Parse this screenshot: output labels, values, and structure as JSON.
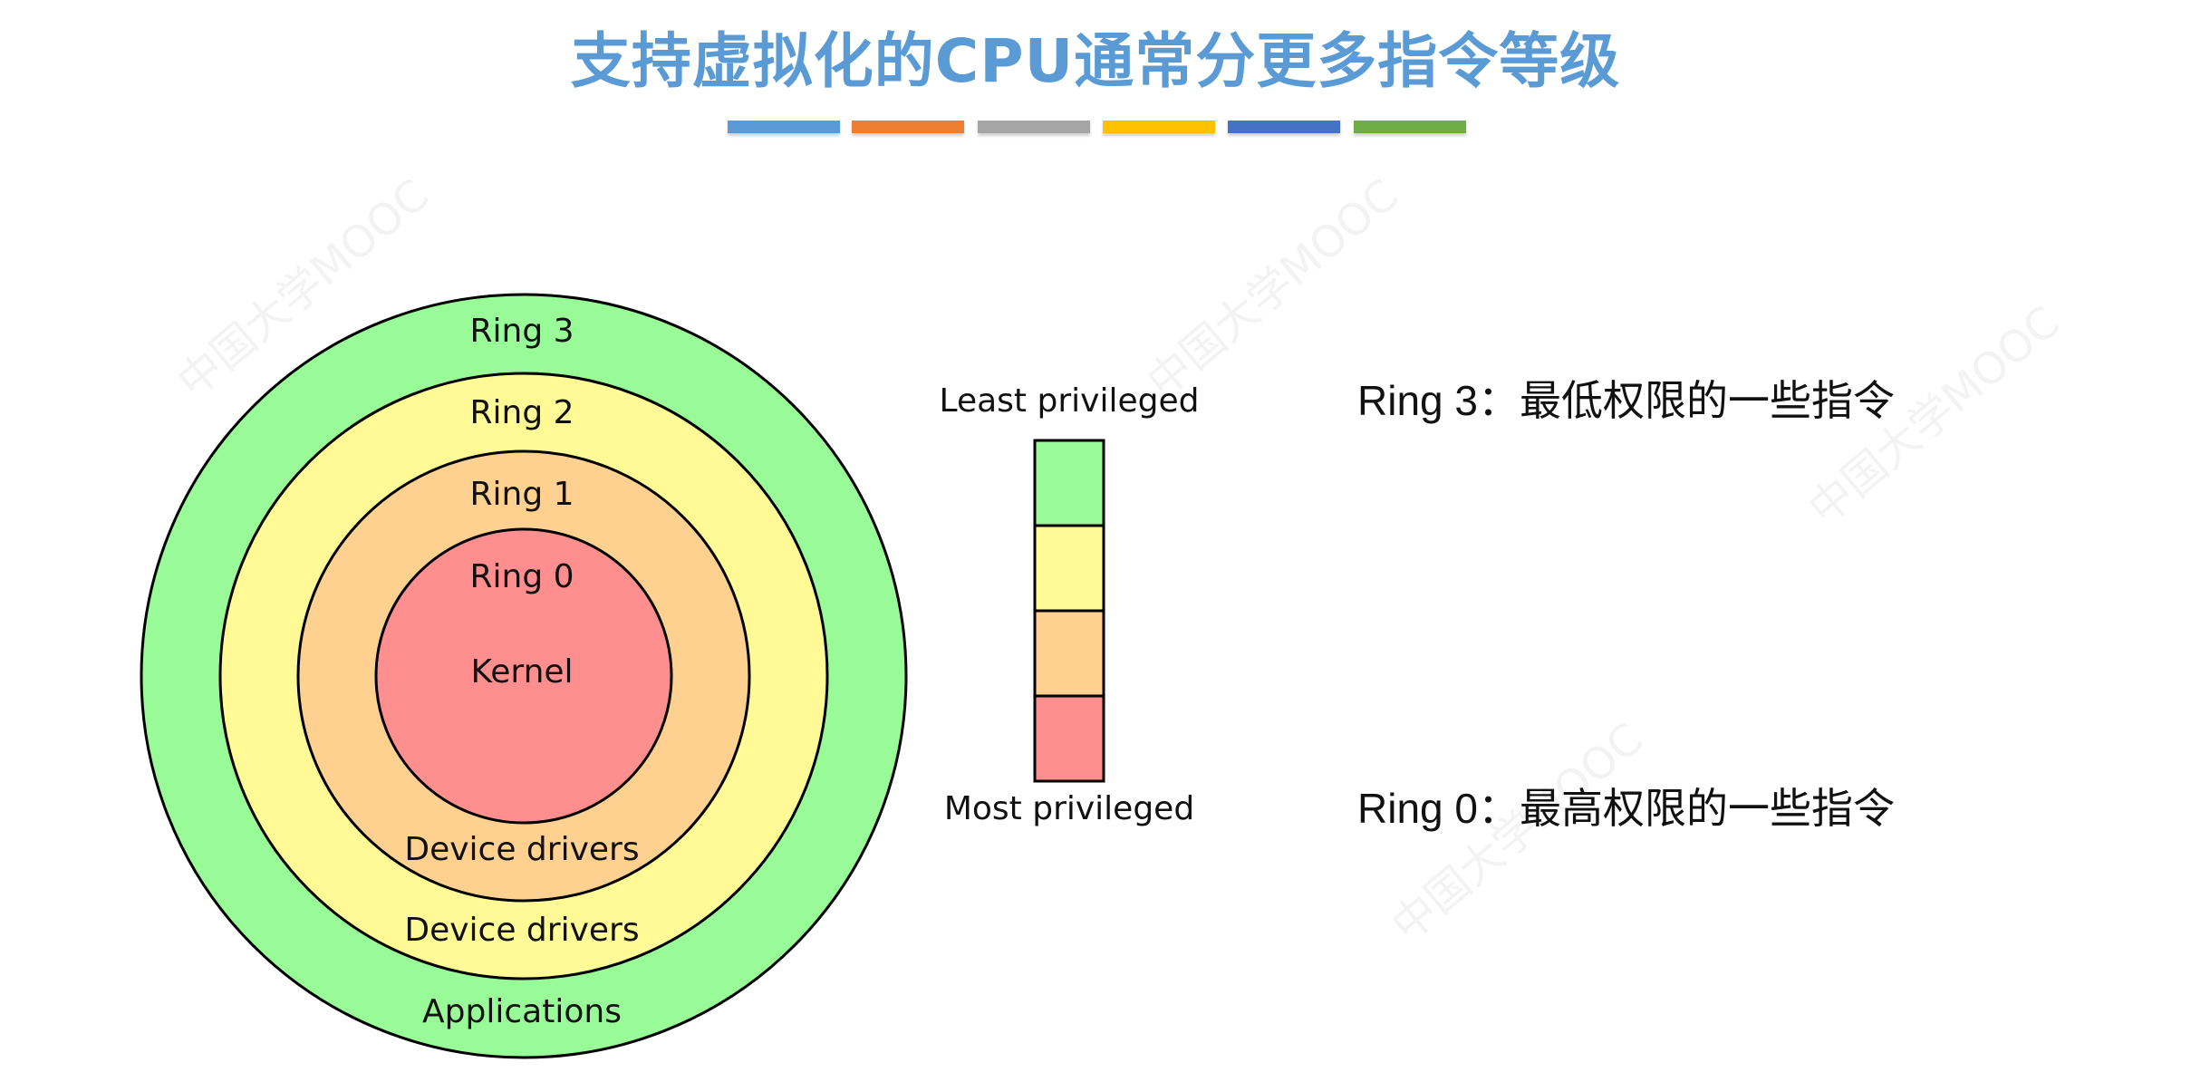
{
  "slide": {
    "title": "支持虚拟化的CPU通常分更多指令等级",
    "accent_bars": [
      "#5b9bd5",
      "#ed7d31",
      "#a5a5a5",
      "#ffc000",
      "#4472c4",
      "#70ad47"
    ]
  },
  "rings_diagram": {
    "rings": [
      {
        "name": "Ring 3",
        "contents": "Applications",
        "color": "#98fb98"
      },
      {
        "name": "Ring 2",
        "contents": "Device drivers",
        "color": "#fffa96"
      },
      {
        "name": "Ring 1",
        "contents": "Device drivers",
        "color": "#ffd190"
      },
      {
        "name": "Ring 0",
        "contents": "Kernel",
        "color": "#ff8f8f"
      }
    ]
  },
  "privilege_scale": {
    "top_label": "Least privileged",
    "bottom_label": "Most privileged",
    "colors": [
      "#98fb98",
      "#fffa96",
      "#ffd190",
      "#ff8f8f"
    ]
  },
  "notes": [
    {
      "ring": "Ring 3",
      "separator": "：",
      "text": "最低权限的一些指令"
    },
    {
      "ring": "Ring 0",
      "separator": "：",
      "text": "最高权限的一些指令"
    }
  ],
  "watermark": {
    "text": "中国大学MOOC"
  }
}
